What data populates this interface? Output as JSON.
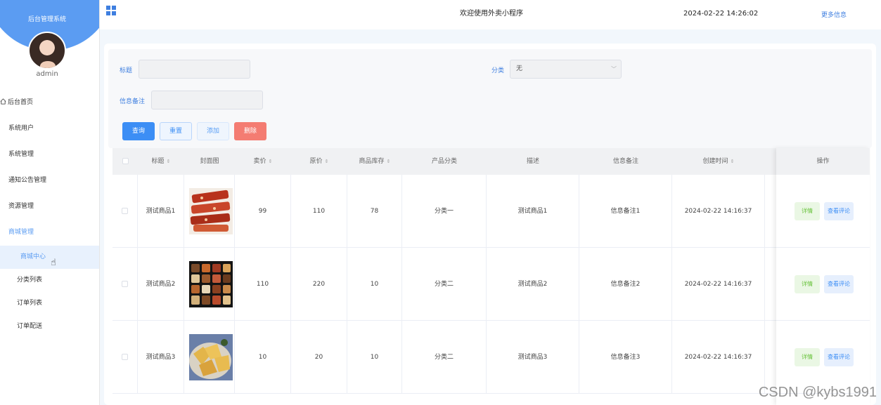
{
  "sidebar": {
    "system_title": "后台管理系统",
    "admin": "admin",
    "menu": [
      {
        "label": "后台首页"
      },
      {
        "label": "系统用户"
      },
      {
        "label": "系统管理"
      },
      {
        "label": "通知公告管理"
      },
      {
        "label": "资源管理"
      },
      {
        "label": "商城管理"
      }
    ],
    "submenu": [
      {
        "label": "商城中心"
      },
      {
        "label": "分类列表"
      },
      {
        "label": "订单列表"
      },
      {
        "label": "订单配送"
      }
    ]
  },
  "header": {
    "welcome": "欢迎使用外卖小程序",
    "datetime": "2024-02-22 14:26:02",
    "more_info": "更多信息"
  },
  "filters": {
    "title_label": "标题",
    "category_label": "分类",
    "category_value": "无",
    "remark_label": "信息备注"
  },
  "buttons": {
    "query": "查询",
    "reset": "重置",
    "add": "添加",
    "delete": "删除"
  },
  "table": {
    "headers": [
      "标题",
      "封面图",
      "卖价",
      "原价",
      "商品库存",
      "产品分类",
      "描述",
      "信息备注",
      "创建时间",
      "操作"
    ],
    "rows": [
      {
        "title": "测试商品1",
        "image": "red-skewers",
        "price": "99",
        "original": "110",
        "stock": "78",
        "category": "分类一",
        "desc": "测试商品1",
        "remark": "信息备注1",
        "created": "2024-02-22 14:16:37"
      },
      {
        "title": "测试商品2",
        "image": "bento-box",
        "price": "110",
        "original": "220",
        "stock": "10",
        "category": "分类二",
        "desc": "测试商品2",
        "remark": "信息备注2",
        "created": "2024-02-22 14:16:37"
      },
      {
        "title": "测试商品3",
        "image": "fried-dish",
        "price": "10",
        "original": "20",
        "stock": "10",
        "category": "分类二",
        "desc": "测试商品3",
        "remark": "信息备注3",
        "created": "2024-02-22 14:16:37"
      }
    ],
    "action_detail": "详情",
    "action_review": "查看评论"
  },
  "watermark": "CSDN @kybs1991",
  "colors": {
    "primary": "#3c8ef5",
    "sidebar_header": "#5b9cf2",
    "danger": "#f47c72",
    "success": "#67c23a"
  }
}
